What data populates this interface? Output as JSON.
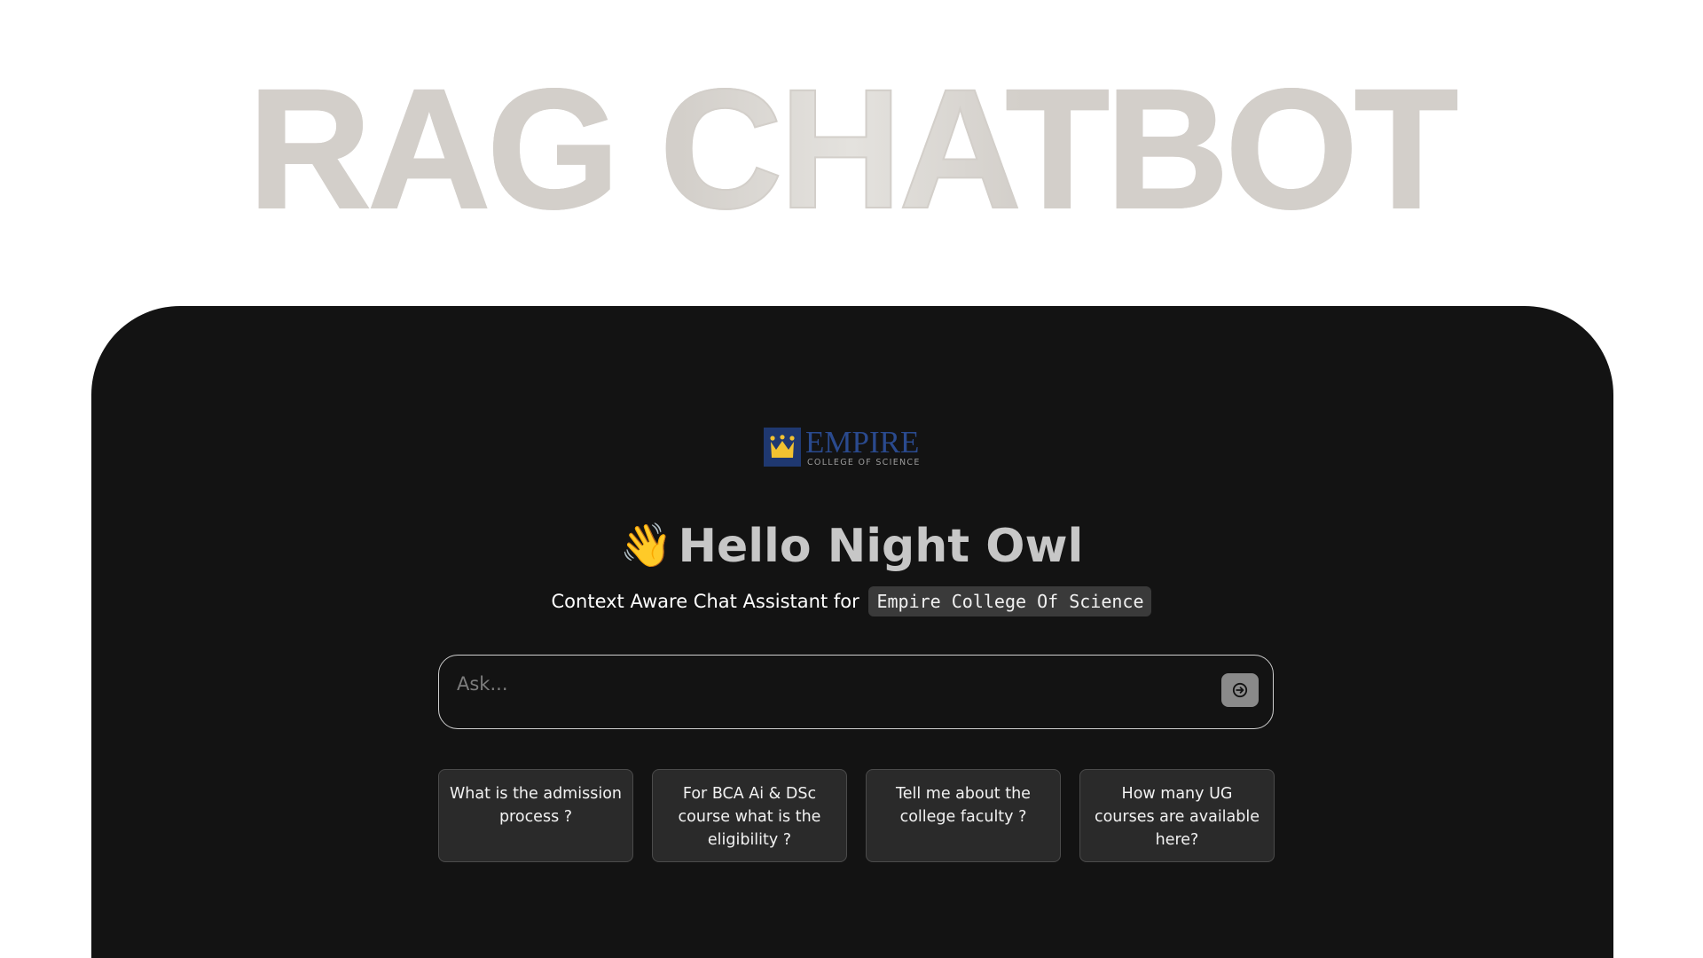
{
  "hero": {
    "title": "RAG CHATBOT"
  },
  "logo": {
    "name": "EMPIRE",
    "subtitle": "COLLEGE OF SCIENCE",
    "icon": "crown-icon",
    "colors": {
      "crest": "#1f3870",
      "name": "#2a4a8e",
      "crown": "#f2c230"
    }
  },
  "greeting": {
    "emoji": "👋",
    "text": "Hello Night Owl"
  },
  "subtitle": {
    "text": "Context Aware Chat Assistant for",
    "college": "Empire College Of Science"
  },
  "ask": {
    "placeholder": "Ask...",
    "value": "",
    "send_icon": "arrow-right-circle-icon"
  },
  "suggestions": [
    {
      "label": "What is the admission process ?"
    },
    {
      "label": "For BCA Ai & DSc course what is the eligibility ?"
    },
    {
      "label": "Tell me about the college faculty ?"
    },
    {
      "label": "How many UG courses are available here?"
    }
  ],
  "colors": {
    "panel_bg": "#131313",
    "hero_text": "#d3cfca",
    "card_bg": "#2a2a2a",
    "send_button": "#8a8a8a"
  }
}
